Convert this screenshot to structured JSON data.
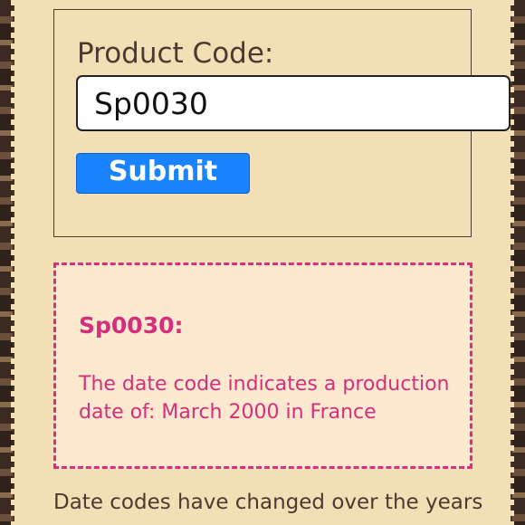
{
  "form": {
    "label": "Product Code:",
    "input_value": "Sp0030",
    "submit_label": "Submit"
  },
  "result": {
    "code": "Sp0030:",
    "message": "The date code indicates a production date of: March 2000 in France"
  },
  "footer": {
    "text": "Date codes have changed over the years"
  },
  "colors": {
    "accent_pink": "#d42f7c",
    "button_blue": "#1a84ff",
    "background_tan": "#f3dfb6"
  }
}
